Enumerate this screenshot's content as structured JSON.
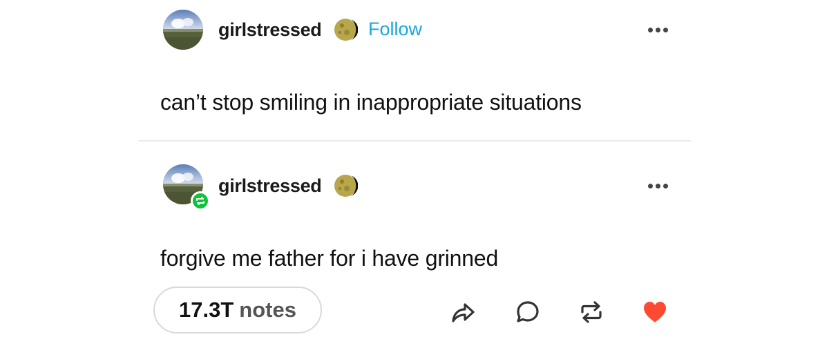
{
  "original_post": {
    "username": "girlstressed",
    "follow_label": "Follow",
    "text": "can’t stop smiling in inappropriate situations",
    "avatar_icon": "globe-avatar-icon",
    "badge_icon": "moon-icon"
  },
  "reblog_post": {
    "username": "girlstressed",
    "text": "forgive me father for i have grinned",
    "avatar_icon": "globe-avatar-icon",
    "badge_icon": "moon-icon",
    "reblog_badge_icon": "reblog-icon"
  },
  "footer": {
    "notes_count": "17.3T",
    "notes_label": "notes",
    "actions": [
      "share-icon",
      "reply-icon",
      "reblog-icon",
      "like-icon"
    ]
  },
  "colors": {
    "follow": "#1aa5e0",
    "reblog_badge": "#10c23b",
    "like": "#ff4930",
    "divider": "#ebebeb"
  }
}
